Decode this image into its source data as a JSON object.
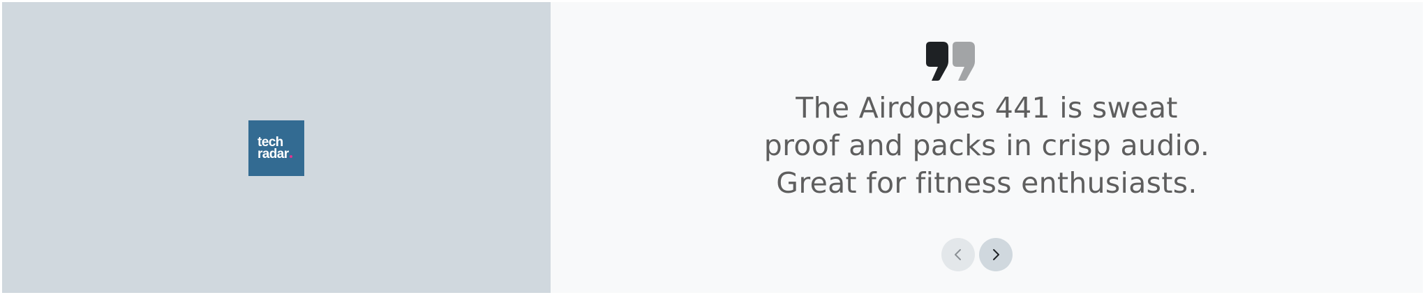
{
  "brand": {
    "logo_line1": "tech",
    "logo_line2": "radar",
    "logo_bg": "#336b92",
    "logo_dot_color": "#e0338f"
  },
  "testimonial": {
    "quote_lines": [
      "The Airdopes 441 is sweat",
      "proof and packs in crisp audio.",
      "Great for fitness enthusiasts."
    ],
    "quote_icon": "quote-icon"
  },
  "navigation": {
    "prev_icon": "chevron-left-icon",
    "next_icon": "chevron-right-icon"
  },
  "colors": {
    "left_panel_bg": "#d0d8de",
    "right_panel_bg": "#f8f9fa",
    "text": "#5e5e5e"
  }
}
